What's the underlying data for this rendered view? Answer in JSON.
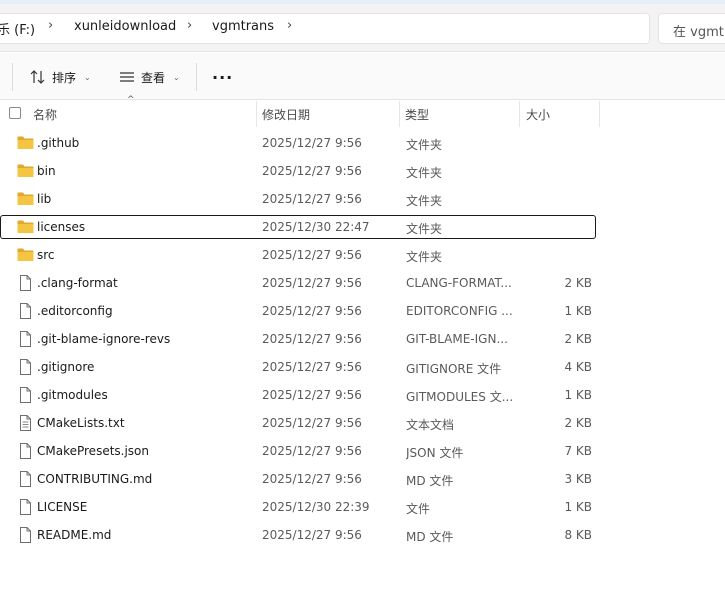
{
  "breadcrumb": {
    "items": [
      "乐 (F:)",
      "xunleidownload",
      "vgmtrans"
    ]
  },
  "search": {
    "placeholder": "在 vgmtrans 中搜索"
  },
  "toolbar": {
    "sort_label": "排序",
    "view_label": "查看",
    "more_label": "···"
  },
  "columns": {
    "name": "名称",
    "date": "修改日期",
    "type": "类型",
    "size": "大小"
  },
  "files": [
    {
      "name": ".github",
      "date": "2025/12/27 9:56",
      "type": "文件夹",
      "size": "",
      "icon": "folder-icon"
    },
    {
      "name": "bin",
      "date": "2025/12/27 9:56",
      "type": "文件夹",
      "size": "",
      "icon": "folder-icon"
    },
    {
      "name": "lib",
      "date": "2025/12/27 9:56",
      "type": "文件夹",
      "size": "",
      "icon": "folder-icon"
    },
    {
      "name": "licenses",
      "date": "2025/12/30 22:47",
      "type": "文件夹",
      "size": "",
      "icon": "folder-icon",
      "selected": true
    },
    {
      "name": "src",
      "date": "2025/12/27 9:56",
      "type": "文件夹",
      "size": "",
      "icon": "folder-icon"
    },
    {
      "name": ".clang-format",
      "date": "2025/12/27 9:56",
      "type": "CLANG-FORMAT...",
      "size": "2 KB",
      "icon": "file-icon"
    },
    {
      "name": ".editorconfig",
      "date": "2025/12/27 9:56",
      "type": "EDITORCONFIG ...",
      "size": "1 KB",
      "icon": "file-icon"
    },
    {
      "name": ".git-blame-ignore-revs",
      "date": "2025/12/27 9:56",
      "type": "GIT-BLAME-IGN...",
      "size": "2 KB",
      "icon": "file-icon"
    },
    {
      "name": ".gitignore",
      "date": "2025/12/27 9:56",
      "type": "GITIGNORE 文件",
      "size": "4 KB",
      "icon": "file-icon"
    },
    {
      "name": ".gitmodules",
      "date": "2025/12/27 9:56",
      "type": "GITMODULES 文...",
      "size": "1 KB",
      "icon": "file-icon"
    },
    {
      "name": "CMakeLists.txt",
      "date": "2025/12/27 9:56",
      "type": "文本文档",
      "size": "2 KB",
      "icon": "text-file-icon"
    },
    {
      "name": "CMakePresets.json",
      "date": "2025/12/27 9:56",
      "type": "JSON 文件",
      "size": "7 KB",
      "icon": "file-icon"
    },
    {
      "name": "CONTRIBUTING.md",
      "date": "2025/12/27 9:56",
      "type": "MD 文件",
      "size": "3 KB",
      "icon": "file-icon"
    },
    {
      "name": "LICENSE",
      "date": "2025/12/30 22:39",
      "type": "文件",
      "size": "1 KB",
      "icon": "file-icon"
    },
    {
      "name": "README.md",
      "date": "2025/12/27 9:56",
      "type": "MD 文件",
      "size": "8 KB",
      "icon": "file-icon"
    }
  ],
  "colors": {
    "folder": "#f4c542",
    "folder_dark": "#e0a82e",
    "selection_border": "#1a1a1a"
  }
}
